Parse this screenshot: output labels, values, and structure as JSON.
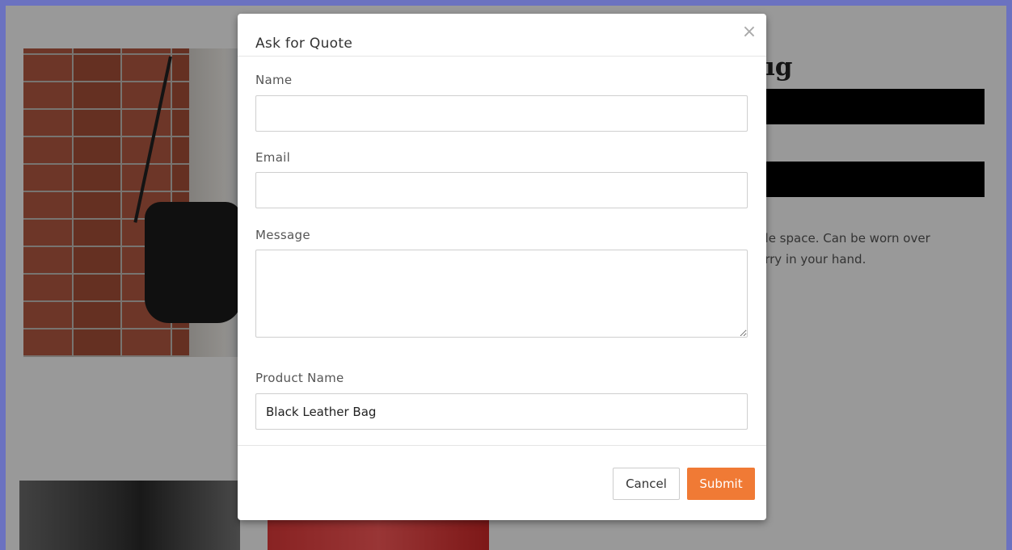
{
  "background": {
    "product_title_fragment": "ıg",
    "description_line1": "ble space. Can be worn over",
    "description_line2": "arry in your hand."
  },
  "modal": {
    "title": "Ask for Quote",
    "close_icon": "×",
    "fields": {
      "name_label": "Name",
      "name_value": "",
      "email_label": "Email",
      "email_value": "",
      "message_label": "Message",
      "message_value": "",
      "product_label": "Product Name",
      "product_value": "Black Leather Bag"
    },
    "buttons": {
      "cancel": "Cancel",
      "submit": "Submit"
    }
  },
  "colors": {
    "accent": "#f07a35",
    "frame": "#6b72c0"
  }
}
